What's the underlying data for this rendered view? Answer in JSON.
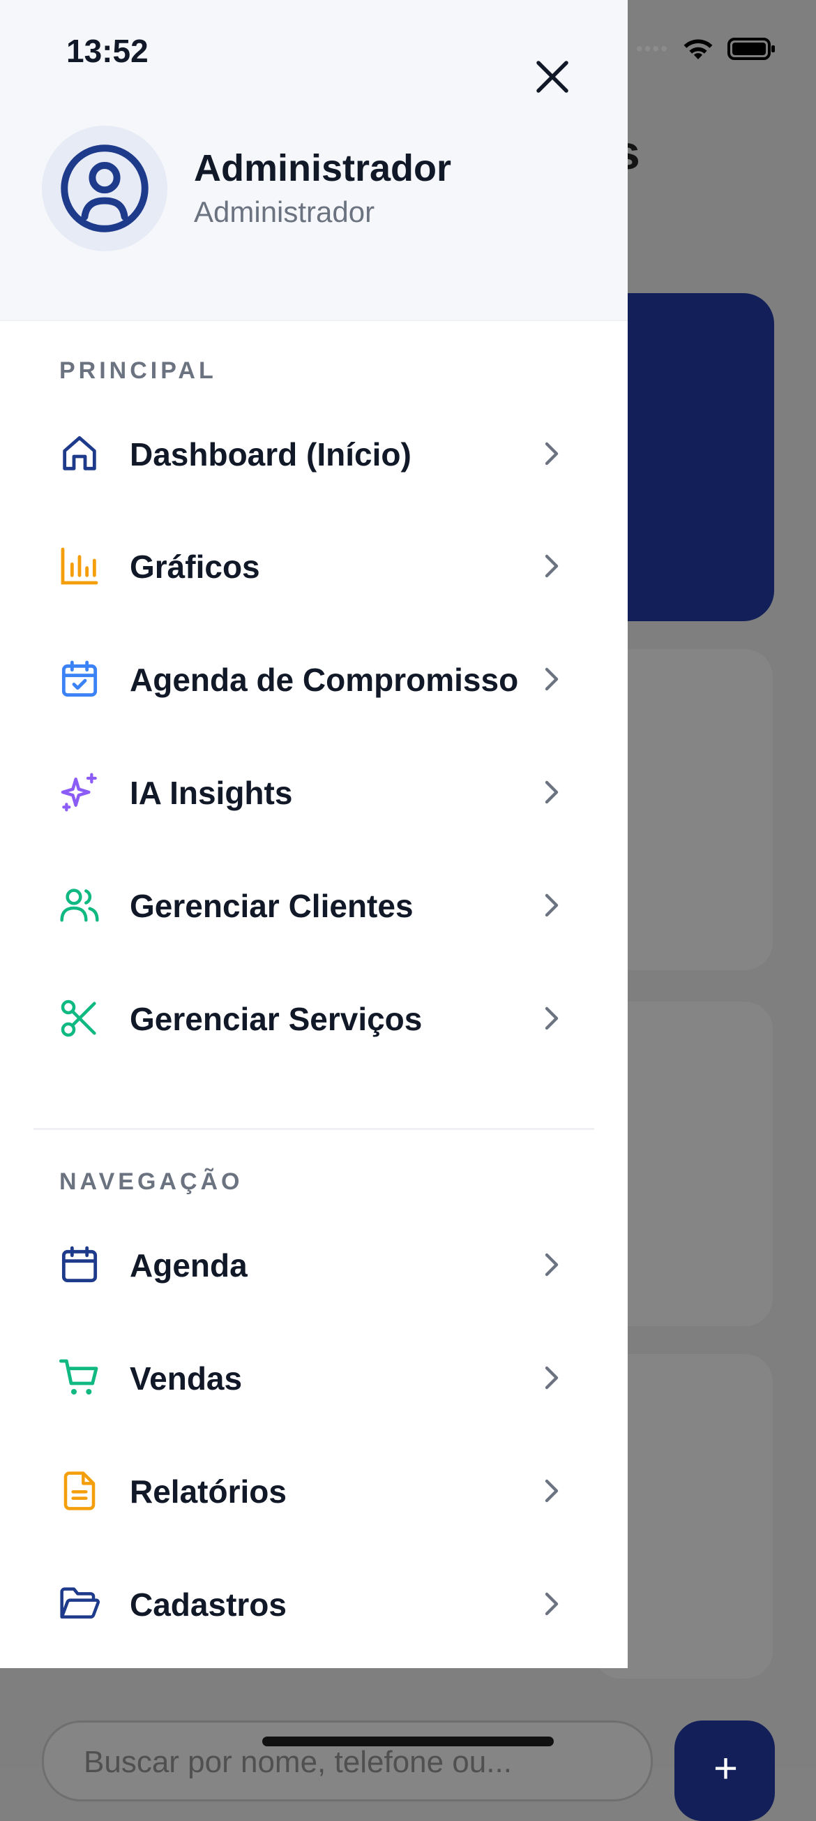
{
  "status_bar": {
    "time": "13:52"
  },
  "background": {
    "title_fragment": "s",
    "search_placeholder": "Buscar por nome, telefone ou...",
    "fab_icon": "plus-icon"
  },
  "drawer": {
    "user": {
      "name": "Administrador",
      "role": "Administrador",
      "avatar_icon": "user-circle-icon"
    },
    "close_icon": "close-icon",
    "sections": [
      {
        "label": "PRINCIPAL",
        "items": [
          {
            "label": "Dashboard (Início)",
            "icon": "home-icon",
            "color": "#1e3a8a"
          },
          {
            "label": "Gráficos",
            "icon": "bar-chart-icon",
            "color": "#f59e0b"
          },
          {
            "label": "Agenda de Compromisso",
            "icon": "calendar-check-icon",
            "color": "#3b82f6"
          },
          {
            "label": "IA Insights",
            "icon": "sparkles-icon",
            "color": "#8b5cf6"
          },
          {
            "label": "Gerenciar Clientes",
            "icon": "users-icon",
            "color": "#10b981"
          },
          {
            "label": "Gerenciar Serviços",
            "icon": "scissors-icon",
            "color": "#10b981"
          }
        ]
      },
      {
        "label": "NAVEGAÇÃO",
        "items": [
          {
            "label": "Agenda",
            "icon": "calendar-icon",
            "color": "#1e3a8a"
          },
          {
            "label": "Vendas",
            "icon": "cart-icon",
            "color": "#10b981"
          },
          {
            "label": "Relatórios",
            "icon": "file-text-icon",
            "color": "#f59e0b"
          },
          {
            "label": "Cadastros",
            "icon": "folder-open-icon",
            "color": "#1e3a8a"
          }
        ]
      }
    ]
  }
}
